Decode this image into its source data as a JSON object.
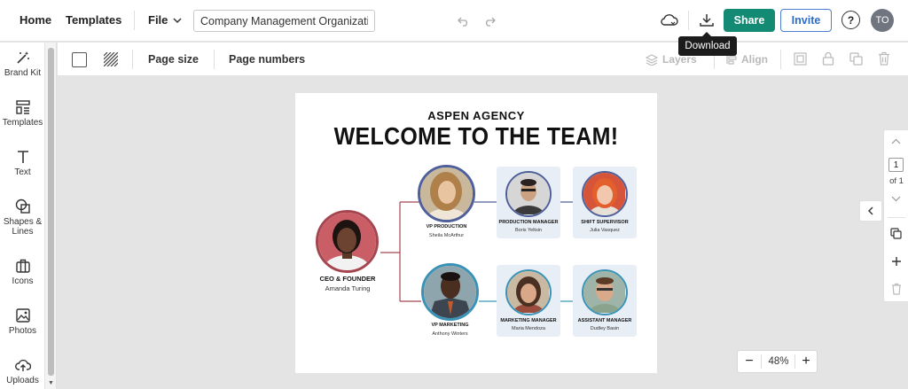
{
  "header": {
    "home": "Home",
    "templates": "Templates",
    "file_menu": "File",
    "document_title": "Company Management Organizati...",
    "share": "Share",
    "invite": "Invite",
    "help": "?",
    "avatar_initials": "TO",
    "download_tooltip": "Download"
  },
  "sidebar": {
    "items": [
      {
        "label": "Brand Kit",
        "icon": "magic-wand-icon"
      },
      {
        "label": "Templates",
        "icon": "templates-icon"
      },
      {
        "label": "Text",
        "icon": "text-icon"
      },
      {
        "label": "Shapes & Lines",
        "icon": "shapes-icon"
      },
      {
        "label": "Icons",
        "icon": "briefcase-icon"
      },
      {
        "label": "Photos",
        "icon": "image-icon"
      },
      {
        "label": "Uploads",
        "icon": "upload-icon"
      }
    ]
  },
  "toolbar": {
    "page_size": "Page size",
    "page_numbers": "Page numbers",
    "layers": "Layers",
    "align": "Align"
  },
  "canvas": {
    "agency": "ASPEN AGENCY",
    "headline": "WELCOME TO THE TEAM!",
    "ceo": {
      "role": "CEO & FOUNDER",
      "name": "Amanda Turing"
    },
    "vp_production": {
      "role": "VP PRODUCTION",
      "name": "Sheila McArthur"
    },
    "vp_marketing": {
      "role": "VP MARKETING",
      "name": "Anthony Winters"
    },
    "production_manager": {
      "role": "PRODUCTION MANAGER",
      "name": "Boris Yeltsin"
    },
    "shift_supervisor": {
      "role": "SHIFT SUPERVISOR",
      "name": "Julia Vasquez"
    },
    "marketing_manager": {
      "role": "MARKETING MANAGER",
      "name": "Maria Mendoza"
    },
    "assistant_manager": {
      "role": "ASSISTANT MANAGER",
      "name": "Dudley Basin"
    },
    "colors": {
      "ceo_ring": "#a5454f",
      "production_ring": "#4f5f9a",
      "marketing_ring": "#3a93b6",
      "card_bg": "#e8eef5"
    }
  },
  "pager": {
    "current": "1",
    "of_label": "of 1"
  },
  "zoom": {
    "minus": "−",
    "value": "48%",
    "plus": "+"
  }
}
